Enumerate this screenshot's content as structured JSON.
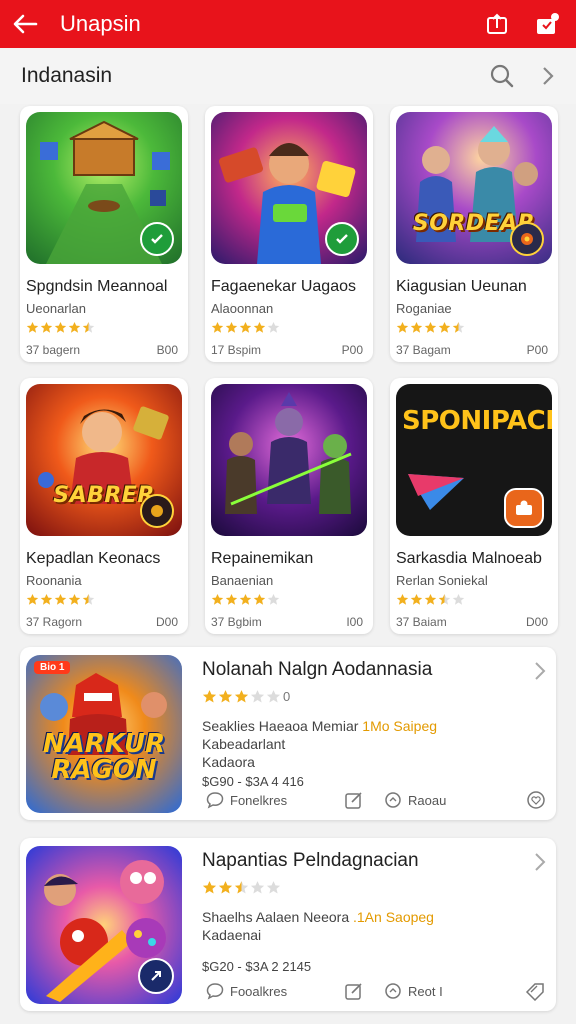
{
  "appbar": {
    "title": "Unapsin",
    "color": "#e8131b"
  },
  "subbar": {
    "title": "Indanasin"
  },
  "cards": [
    {
      "name": "Spgndsin Meannoal",
      "dev": "Ueonarlan",
      "rating": 4.5,
      "downloads": "37 bagern",
      "price": "B00",
      "thumb": "thumb-0",
      "badge": "#1f9d3a"
    },
    {
      "name": "Fagaenekar Uagaos",
      "dev": "Alaoonnan",
      "rating": 4,
      "downloads": "17 Bspim",
      "price": "P00",
      "thumb": "thumb-1",
      "badge": "#1f9d3a"
    },
    {
      "name": "Kiagusian Ueunan",
      "dev": "Roganiae",
      "rating": 4.5,
      "downloads": "37 Bagam",
      "price": "P00",
      "thumb": "thumb-2",
      "logo": "SORDEAR"
    },
    {
      "name": "Kepadlan Keonacs",
      "dev": "Roonania",
      "rating": 4.5,
      "downloads": "37 Ragorn",
      "price": "D00",
      "thumb": "thumb-3",
      "logo": "SABRER"
    },
    {
      "name": "Repainemikan",
      "dev": "Banaenian",
      "rating": 4,
      "downloads": "37 Bgbim",
      "price": "I00",
      "thumb": "thumb-4"
    },
    {
      "name": "Sarkasdia Malnoeab",
      "dev": "Rerlan Soniekal",
      "rating": 3.5,
      "downloads": "37 Baiam",
      "price": "D00",
      "thumb": "thumb-5",
      "logo": "SPONIPACI",
      "badge": "#e9661b"
    }
  ],
  "items": [
    {
      "name": "Nolanah Nalgn Aodannasia",
      "rating": 3,
      "rating_text": "0",
      "desc": "Seaklies Haeaoa Memiar",
      "desc_highlight": "1Mo Saipeg",
      "dev": "Kabeadarlant",
      "loc": "Kadaora",
      "price": "$G90 - $3A 4 416",
      "tag": "Bio 1",
      "logo_line1": "NARKUR",
      "logo_line2": "RAGON",
      "action1": "Fonelkres",
      "action3": "Raoau"
    },
    {
      "name": "Napantias Pelndagnacian",
      "rating": 2.5,
      "rating_text": "",
      "desc": "Shaelhs Aalaen Neeora",
      "desc_highlight": ".1An Saopeg",
      "dev": "Kadaenai",
      "loc": "",
      "price": "$G20 - $3A 2 2145",
      "action1": "Fooalkres",
      "action3": "Reot I"
    }
  ]
}
